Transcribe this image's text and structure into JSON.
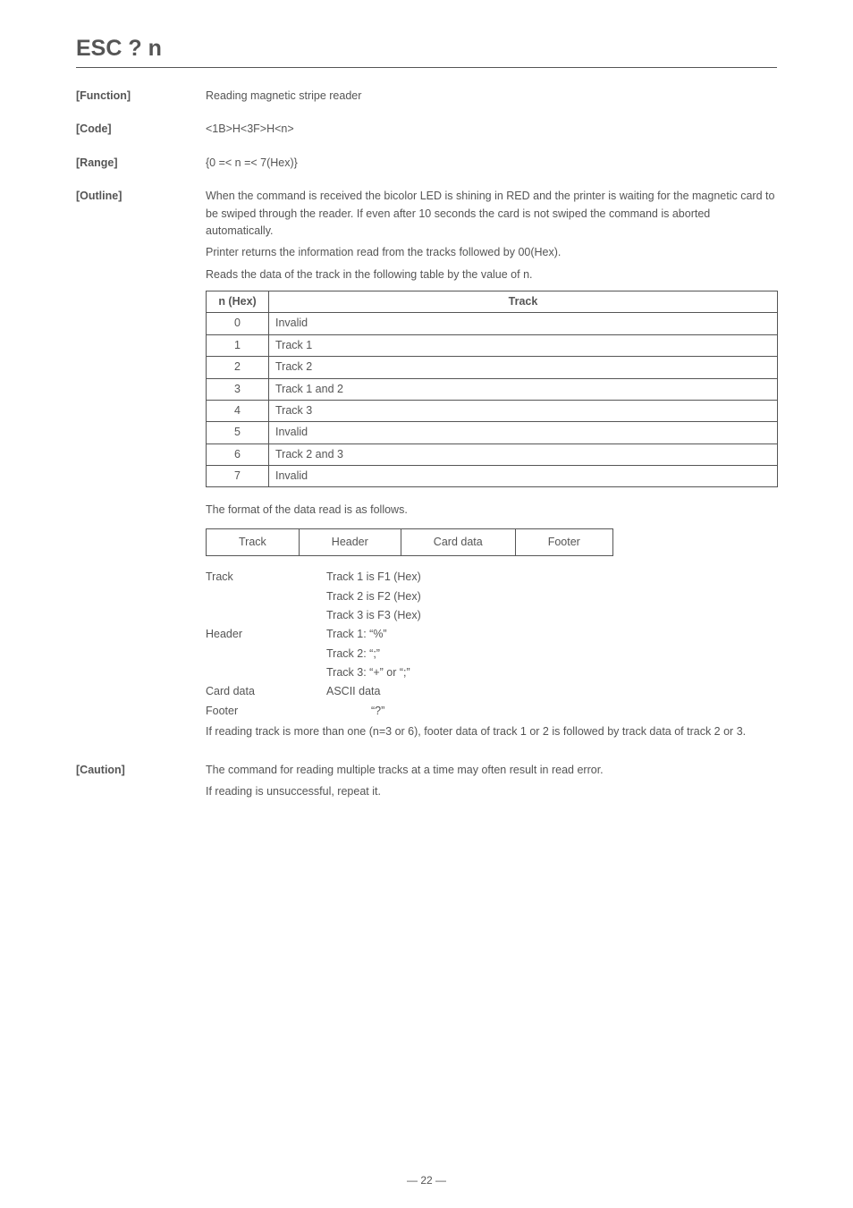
{
  "title": "ESC ? n",
  "sections": {
    "function": {
      "label": "[Function]",
      "text": "Reading magnetic stripe reader"
    },
    "code": {
      "label": "[Code]",
      "text": "<1B>H<3F>H<n>"
    },
    "range": {
      "label": "[Range]",
      "text": "{0 =< n =< 7(Hex)}"
    },
    "outline": {
      "label": "[Outline]",
      "paragraphs": [
        "When the command is received the bicolor LED is shining in RED and the printer is waiting for the magnetic card to be swiped through the reader.   If even after 10 seconds the card is not swiped the command is aborted automatically.",
        "Printer returns the information read from the tracks followed by 00(Hex).",
        "Reads the data of the track in the following table by the value of n."
      ]
    },
    "caution": {
      "label": "[Caution]",
      "lines": [
        "The command for reading multiple tracks at a time may often result in read error.",
        "If reading is unsuccessful, repeat it."
      ]
    }
  },
  "tracks_table": {
    "headers": {
      "n": "n (Hex)",
      "track": "Track"
    },
    "rows": [
      {
        "n": "0",
        "track": "Invalid"
      },
      {
        "n": "1",
        "track": "Track 1"
      },
      {
        "n": "2",
        "track": "Track 2"
      },
      {
        "n": "3",
        "track": "Track 1 and 2"
      },
      {
        "n": "4",
        "track": "Track 3"
      },
      {
        "n": "5",
        "track": "Invalid"
      },
      {
        "n": "6",
        "track": "Track 2 and 3"
      },
      {
        "n": "7",
        "track": "Invalid"
      }
    ]
  },
  "format_intro": "The format of the data read is as follows.",
  "format_cells": [
    "Track",
    "Header",
    "Card data",
    "Footer"
  ],
  "defs": {
    "track": {
      "key": "Track",
      "vals": [
        "Track 1 is F1 (Hex)",
        "Track 2 is F2 (Hex)",
        "Track 3 is F3 (Hex)"
      ]
    },
    "header": {
      "key": "Header",
      "vals": [
        "Track 1: “%”",
        "Track 2: “;”",
        "Track 3: “+” or “;”"
      ]
    },
    "carddata": {
      "key": "Card data",
      "val": "ASCII data"
    },
    "footer": {
      "key": "Footer",
      "val": "“?”"
    },
    "note": "If reading track is more than one (n=3 or 6), footer data of track 1 or 2 is followed by track data of track 2 or 3."
  },
  "pagenum": "— 22 —"
}
